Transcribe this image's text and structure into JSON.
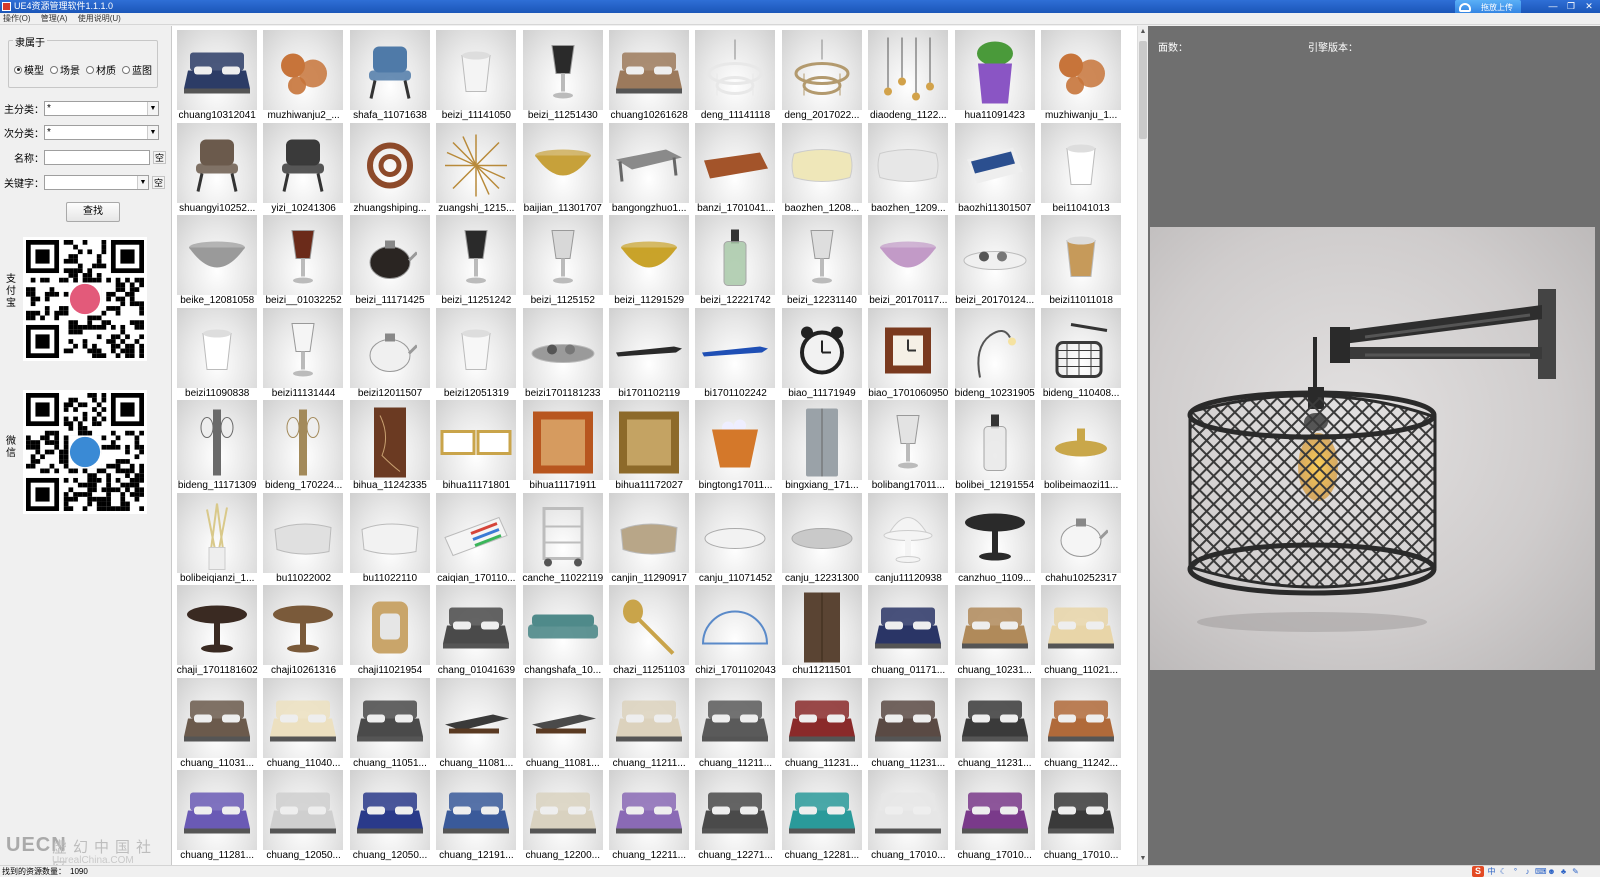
{
  "window": {
    "title": "UE4资源管理软件1.1.1.0",
    "upload_label": "拖放上传",
    "controls": [
      "—",
      "❐",
      "✕"
    ]
  },
  "menu": [
    "操作(O)",
    "管理(A)",
    "使用说明(U)"
  ],
  "filter": {
    "group_label": "隶属于",
    "radios": [
      {
        "label": "模型",
        "checked": true
      },
      {
        "label": "场景",
        "checked": false
      },
      {
        "label": "材质",
        "checked": false
      },
      {
        "label": "蓝图",
        "checked": false
      }
    ],
    "main_category_label": "主分类：",
    "main_category_value": "*",
    "sub_category_label": "次分类：",
    "sub_category_value": "*",
    "name_label": "名称：",
    "name_value": "",
    "clear_label": "空",
    "keyword_label": "关键字：",
    "keyword_value": "",
    "search_label": "查找"
  },
  "qr": {
    "alipay_label": "支付宝",
    "wechat_label": "微信"
  },
  "watermark": {
    "logo": "UECN",
    "cn": "虚幻中国社区",
    "url": "UnrealChina.COM"
  },
  "status": {
    "found_label": "找到的资源数量：",
    "found_count": "1090"
  },
  "right_panel": {
    "faces_label": "面数：",
    "engine_label": "引擎版本："
  },
  "assets": [
    {
      "name": "chuang10312041",
      "icon": "bed",
      "color": "#2c3c66"
    },
    {
      "name": "muzhiwanju2_...",
      "icon": "toy",
      "color": "#c7743a"
    },
    {
      "name": "shafa_11071638",
      "icon": "chair",
      "color": "#4f7aa8"
    },
    {
      "name": "beizi_11141050",
      "icon": "cup",
      "color": "#f4f4f4"
    },
    {
      "name": "beizi_11251430",
      "icon": "glass",
      "color": "#2a2a2a"
    },
    {
      "name": "chuang10261628",
      "icon": "bed",
      "color": "#9c7a5c"
    },
    {
      "name": "deng_11141118",
      "icon": "chandelier",
      "color": "#e8e8e8"
    },
    {
      "name": "deng_2017022...",
      "icon": "chandelier",
      "color": "#b39a6e"
    },
    {
      "name": "diaodeng_1122...",
      "icon": "pendant",
      "color": "#d2a24a"
    },
    {
      "name": "hua11091423",
      "icon": "plant",
      "color": "#8a55c4"
    },
    {
      "name": "muzhiwanju_1...",
      "icon": "toy",
      "color": "#c7743a"
    },
    {
      "name": "shuangyi10252...",
      "icon": "chair",
      "color": "#6b5a4c"
    },
    {
      "name": "yizi_10241306",
      "icon": "chair",
      "color": "#3a3a3a"
    },
    {
      "name": "zhuangshiping...",
      "icon": "ball",
      "color": "#8d4a2a"
    },
    {
      "name": "zuangshi_1215...",
      "icon": "spark",
      "color": "#b88a3a"
    },
    {
      "name": "baijian_11301707",
      "icon": "bowl",
      "color": "#c7a13a"
    },
    {
      "name": "bangongzhuo1...",
      "icon": "desk",
      "color": "#8a8a8a"
    },
    {
      "name": "banzi_1701041...",
      "icon": "board",
      "color": "#a3542a"
    },
    {
      "name": "baozhen_1208...",
      "icon": "pillow",
      "color": "#efe7b9"
    },
    {
      "name": "baozhen_1209...",
      "icon": "pillow",
      "color": "#e7e7e7"
    },
    {
      "name": "baozhi11301507",
      "icon": "paper",
      "color": "#2b4f8f"
    },
    {
      "name": "bei11041013",
      "icon": "cup",
      "color": "#ffffff"
    },
    {
      "name": "beike_12081058",
      "icon": "bowl",
      "color": "#9a9a9a"
    },
    {
      "name": "beizi__01032252",
      "icon": "glass",
      "color": "#6b2b1a"
    },
    {
      "name": "beizi_11171425",
      "icon": "kettle",
      "color": "#2a2522"
    },
    {
      "name": "beizi_11251242",
      "icon": "glass",
      "color": "#2a2a2a"
    },
    {
      "name": "beizi_1125152",
      "icon": "glass",
      "color": "#d8d8d8"
    },
    {
      "name": "beizi_11291529",
      "icon": "bowl",
      "color": "#c9a32a"
    },
    {
      "name": "beizi_12221742",
      "icon": "bottle",
      "color": "#a9c9a9"
    },
    {
      "name": "beizi_12231140",
      "icon": "glass",
      "color": "#dedede"
    },
    {
      "name": "beizi_20170117...",
      "icon": "bowl",
      "color": "#c29ac7"
    },
    {
      "name": "beizi_20170124...",
      "icon": "tray",
      "color": "#f0f0f0"
    },
    {
      "name": "beizi11011018",
      "icon": "cup",
      "color": "#c69a5a"
    },
    {
      "name": "beizi11090838",
      "icon": "cup",
      "color": "#ffffff"
    },
    {
      "name": "beizi11131444",
      "icon": "glass",
      "color": "#f5f5f5"
    },
    {
      "name": "beizi12011507",
      "icon": "kettle",
      "color": "#f0f0f0"
    },
    {
      "name": "beizi12051319",
      "icon": "cup",
      "color": "#f7f7f7"
    },
    {
      "name": "beizi1701181233",
      "icon": "tray",
      "color": "#9a9a9a"
    },
    {
      "name": "bi1701102119",
      "icon": "pen",
      "color": "#2a2a2a"
    },
    {
      "name": "bi1701102242",
      "icon": "pen",
      "color": "#1f4fb5"
    },
    {
      "name": "biao_11171949",
      "icon": "clock",
      "color": "#222222"
    },
    {
      "name": "biao_1701060950",
      "icon": "frameclock",
      "color": "#7a3a1f"
    },
    {
      "name": "bideng_10231905",
      "icon": "lamp",
      "color": "#555555"
    },
    {
      "name": "bideng_110408...",
      "icon": "cage",
      "color": "#3a3a3a"
    },
    {
      "name": "bideng_11171309",
      "icon": "sconce",
      "color": "#6a6a6a"
    },
    {
      "name": "bideng_170224...",
      "icon": "sconce",
      "color": "#a38a5a"
    },
    {
      "name": "bihua_11242335",
      "icon": "panel",
      "color": "#6b3a22"
    },
    {
      "name": "bihua11171801",
      "icon": "frames",
      "color": "#c9a44a"
    },
    {
      "name": "bihua11171911",
      "icon": "painting",
      "color": "#b8561f"
    },
    {
      "name": "bihua11172027",
      "icon": "painting",
      "color": "#8d6a2a"
    },
    {
      "name": "bingtong17011...",
      "icon": "bucket",
      "color": "#d4782a"
    },
    {
      "name": "bingxiang_171...",
      "icon": "fridge",
      "color": "#9aa2a8"
    },
    {
      "name": "bolibang17011...",
      "icon": "glass",
      "color": "#e3e3e3"
    },
    {
      "name": "bolibei_12191554",
      "icon": "bottle",
      "color": "#e9e9e9"
    },
    {
      "name": "bolibeimaozi11...",
      "icon": "lid",
      "color": "#c9a74a"
    },
    {
      "name": "bolibeiqianzi_1...",
      "icon": "vase",
      "color": "#d9c98a"
    },
    {
      "name": "bu11022002",
      "icon": "cloth",
      "color": "#e0e0e0"
    },
    {
      "name": "bu11022110",
      "icon": "cloth",
      "color": "#f2f2f2"
    },
    {
      "name": "caiqian_170110...",
      "icon": "pencils",
      "color": "#d5453a"
    },
    {
      "name": "canche_11022119",
      "icon": "cart",
      "color": "#bdbdbd"
    },
    {
      "name": "canjin_11290917",
      "icon": "cloth",
      "color": "#b8a688"
    },
    {
      "name": "canju_11071452",
      "icon": "plate",
      "color": "#f2f2f2"
    },
    {
      "name": "canju_12231300",
      "icon": "plate",
      "color": "#c9c9c9"
    },
    {
      "name": "canju11120938",
      "icon": "cakestand",
      "color": "#f4f4f4"
    },
    {
      "name": "canzhuo_1109...",
      "icon": "table",
      "color": "#2a2a2a"
    },
    {
      "name": "chahu10252317",
      "icon": "kettle",
      "color": "#f5f5f5"
    },
    {
      "name": "chaji_1701181602",
      "icon": "table",
      "color": "#3a2a22"
    },
    {
      "name": "chaji10261316",
      "icon": "table",
      "color": "#7a5a3a"
    },
    {
      "name": "chaji11021954",
      "icon": "stool",
      "color": "#c9a56a"
    },
    {
      "name": "chang_01041639",
      "icon": "bed",
      "color": "#4a4a4a"
    },
    {
      "name": "changshafa_10...",
      "icon": "sofa",
      "color": "#4f8a8a"
    },
    {
      "name": "chazi_11251103",
      "icon": "spoon",
      "color": "#c9a44a"
    },
    {
      "name": "chizi_1701102043",
      "icon": "ruler",
      "color": "#5a8ac9"
    },
    {
      "name": "chu11211501",
      "icon": "cabinet",
      "color": "#5a4433"
    },
    {
      "name": "chuang_01171...",
      "icon": "bed",
      "color": "#2a3566"
    },
    {
      "name": "chuang_10231...",
      "icon": "bed",
      "color": "#b08a5a"
    },
    {
      "name": "chuang_11021...",
      "icon": "bed",
      "color": "#e8d5a8"
    },
    {
      "name": "chuang_11031...",
      "icon": "bed",
      "color": "#6b5a4c"
    },
    {
      "name": "chuang_11040...",
      "icon": "bed",
      "color": "#ece0c0"
    },
    {
      "name": "chuang_11051...",
      "icon": "bed",
      "color": "#4a4a4a"
    },
    {
      "name": "chuang_11081...",
      "icon": "lounger",
      "color": "#3a3a3a"
    },
    {
      "name": "chuang_11081...",
      "icon": "lounger",
      "color": "#4a4a4a"
    },
    {
      "name": "chuang_11211...",
      "icon": "bed",
      "color": "#dcd2bd"
    },
    {
      "name": "chuang_11211...",
      "icon": "bed",
      "color": "#5a5a5a"
    },
    {
      "name": "chuang_11231...",
      "icon": "bed",
      "color": "#8a2a2a"
    },
    {
      "name": "chuang_11231...",
      "icon": "bed",
      "color": "#5a4a44"
    },
    {
      "name": "chuang_11231...",
      "icon": "bed",
      "color": "#3a3a3a"
    },
    {
      "name": "chuang_11242...",
      "icon": "bed",
      "color": "#b06a3a"
    },
    {
      "name": "chuang_11281...",
      "icon": "bed",
      "color": "#6a5ab5"
    },
    {
      "name": "chuang_12050...",
      "icon": "bed",
      "color": "#cfcfcf"
    },
    {
      "name": "chuang_12050...",
      "icon": "bed",
      "color": "#2a3a8a"
    },
    {
      "name": "chuang_12191...",
      "icon": "bed",
      "color": "#3a5a9a"
    },
    {
      "name": "chuang_12200...",
      "icon": "bed",
      "color": "#d9d2c0"
    },
    {
      "name": "chuang_12211...",
      "icon": "bed",
      "color": "#8a6ab5"
    },
    {
      "name": "chuang_12271...",
      "icon": "bed",
      "color": "#4a4a4a"
    },
    {
      "name": "chuang_12281...",
      "icon": "bed",
      "color": "#2a9a9a"
    },
    {
      "name": "chuang_17010...",
      "icon": "bed",
      "color": "#e6e6e6"
    },
    {
      "name": "chuang_17010...",
      "icon": "bed",
      "color": "#7a3a8a"
    },
    {
      "name": "chuang_17010...",
      "icon": "bed",
      "color": "#3a3a3a"
    }
  ]
}
